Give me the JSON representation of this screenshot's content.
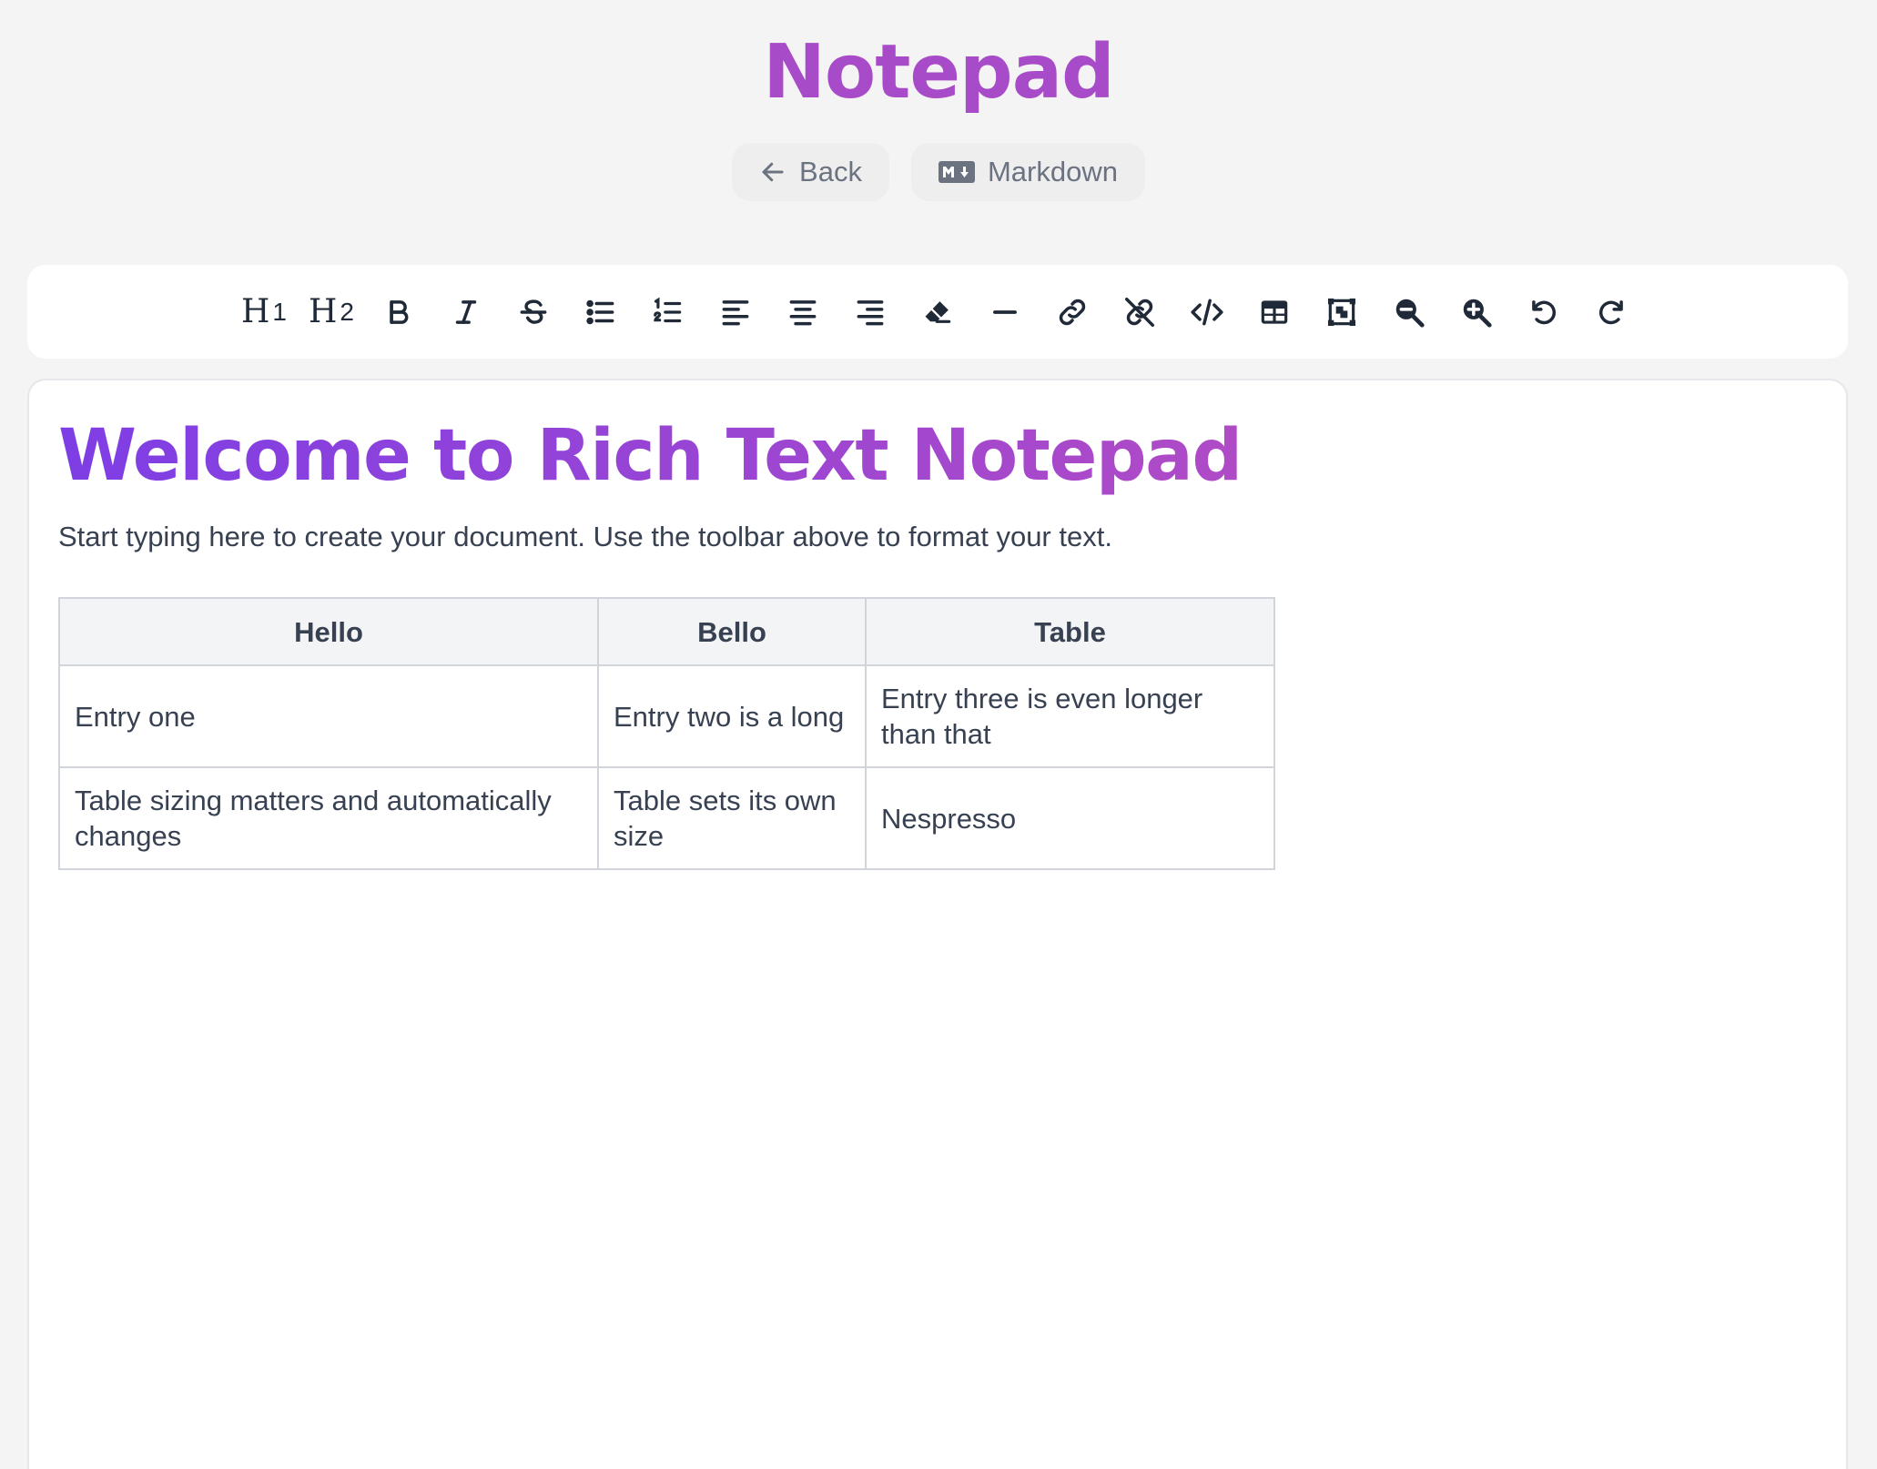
{
  "app": {
    "title": "Notepad"
  },
  "nav": {
    "back_label": "Back",
    "markdown_label": "Markdown"
  },
  "toolbar": {
    "h1_label": "H",
    "h1_level": "1",
    "h2_label": "H",
    "h2_level": "2",
    "items": [
      "heading-1",
      "heading-2",
      "bold",
      "italic",
      "strikethrough",
      "bullet-list",
      "ordered-list",
      "align-left",
      "align-center",
      "align-right",
      "clear-format",
      "horizontal-rule",
      "link",
      "unlink",
      "code",
      "table",
      "image",
      "zoom-out",
      "zoom-in",
      "undo",
      "redo"
    ]
  },
  "document": {
    "heading": "Welcome to Rich Text Notepad",
    "paragraph": "Start typing here to create your document. Use the toolbar above to format your text.",
    "table": {
      "headers": [
        "Hello",
        "Bello",
        "Table"
      ],
      "rows": [
        [
          "Entry one",
          "Entry two is a long",
          "Entry three is even longer than that"
        ],
        [
          "Table sizing matters and automatically changes",
          "Table sets its own size",
          "Nespresso"
        ]
      ]
    }
  },
  "colors": {
    "title": "#a84bc8",
    "heading_gradient_start": "#7e3ee5",
    "heading_gradient_end": "#b04bc6",
    "background": "#f4f4f5"
  }
}
